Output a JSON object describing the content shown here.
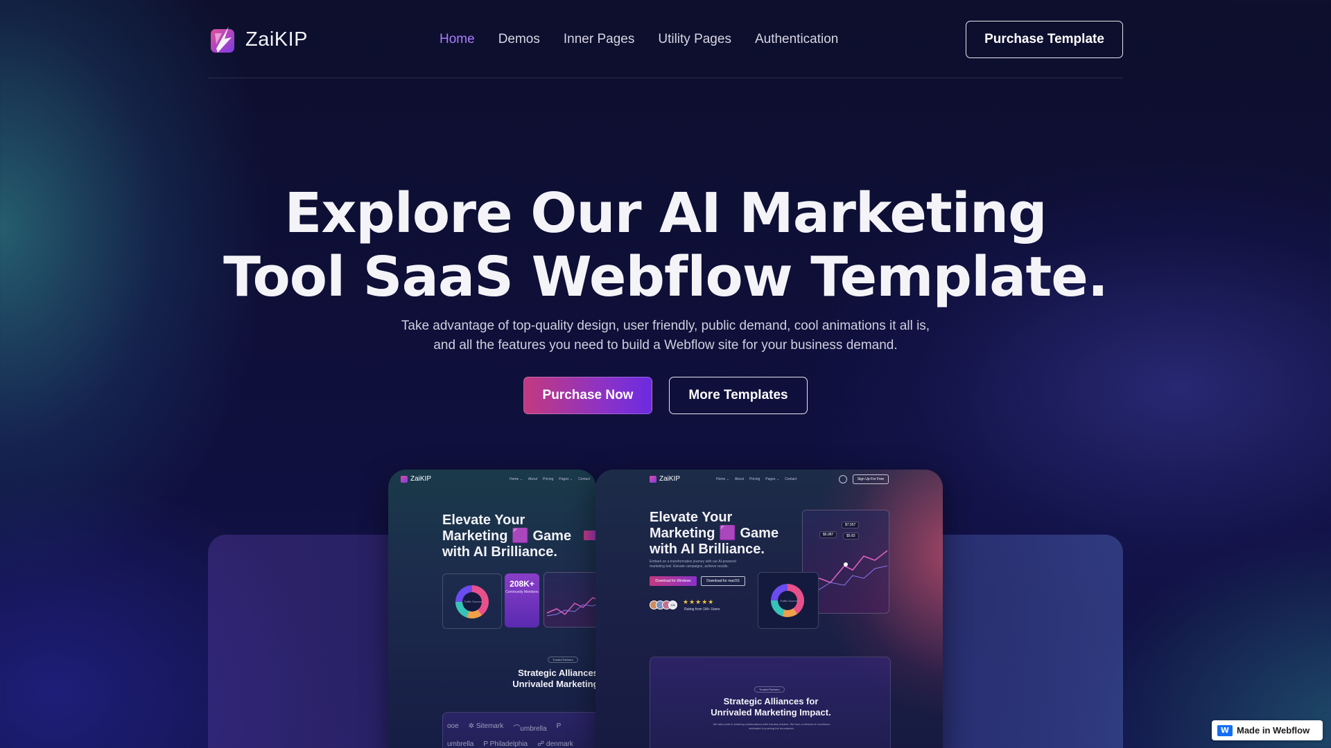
{
  "brand": {
    "name": "ZaiKIP",
    "logo_icon": "zaikip-logo-icon"
  },
  "nav": {
    "items": [
      {
        "label": "Home",
        "active": true
      },
      {
        "label": "Demos",
        "active": false
      },
      {
        "label": "Inner Pages",
        "active": false
      },
      {
        "label": "Utility Pages",
        "active": false
      },
      {
        "label": "Authentication",
        "active": false
      }
    ],
    "cta_label": "Purchase Template"
  },
  "hero": {
    "title_line1": "Explore Our AI Marketing",
    "title_line2": "Tool SaaS Webflow Template.",
    "subtitle_line1": "Take advantage of top-quality design, user friendly, public demand, cool animations it all is,",
    "subtitle_line2": "and all the features you need to build a Webflow site for your business demand.",
    "primary_button": "Purchase Now",
    "secondary_button": "More Templates"
  },
  "preview_left": {
    "brand": "ZaiKIP",
    "links": [
      "Home ⌄",
      "About",
      "Pricing",
      "Pages ⌄",
      "Contact"
    ],
    "headline_line1": "Elevate Your",
    "headline_line2": "Marketing 🟪 Game",
    "headline_line3": "with AI Brilliance.",
    "stat_value": "208K+",
    "stat_label": "Community Members",
    "donut_label": "Traffic Sources",
    "pill": "Trusted Partners",
    "section_title_line1": "Strategic Alliances",
    "section_title_line2": "Unrivaled Marketing I",
    "partners_row1": [
      "ooe",
      "✲ Sitemark",
      "⌒umbrella",
      "P"
    ],
    "partners_row2": [
      "umbrella",
      "P Philadelphia",
      "☍ denmark"
    ]
  },
  "preview_right": {
    "brand": "ZaiKIP",
    "links": [
      "Home ⌄",
      "About",
      "Pricing",
      "Pages ⌄",
      "Contact"
    ],
    "signup": "Sign Up For Free",
    "headline_line1": "Elevate Your",
    "headline_line2": "Marketing 🟪 Game",
    "headline_line3": "with AI Brilliance.",
    "body_text": "Embark on a transformative journey with our AI-powered marketing tool. Elevate campaigns, achieve results.",
    "btn_windows": "Download for Windows",
    "btn_mac": "Download for macOS",
    "rating_stars": "★★★★★",
    "rating_text": "Rating from 1M+ Users",
    "avatar_more": "10k",
    "chart_tags": [
      "$7,557",
      "$6,987",
      "$5.83"
    ],
    "donut_label": "Traffic Sources",
    "pill": "Trusted Partners",
    "section_title_line1": "Strategic Alliances for",
    "section_title_line2": "Unrivaled Marketing Impact.",
    "section_body": "We take pride in fostering collaborations with industry leaders. We form a network of excellence dedicated to pushing the boundaries."
  },
  "badge": {
    "label": "Made in Webflow",
    "icon": "W"
  },
  "colors": {
    "accent_purple": "#a87cff",
    "button_gradient_start": "#c23a7e",
    "button_gradient_end": "#6b2be0",
    "background": "#0f0f3a"
  }
}
